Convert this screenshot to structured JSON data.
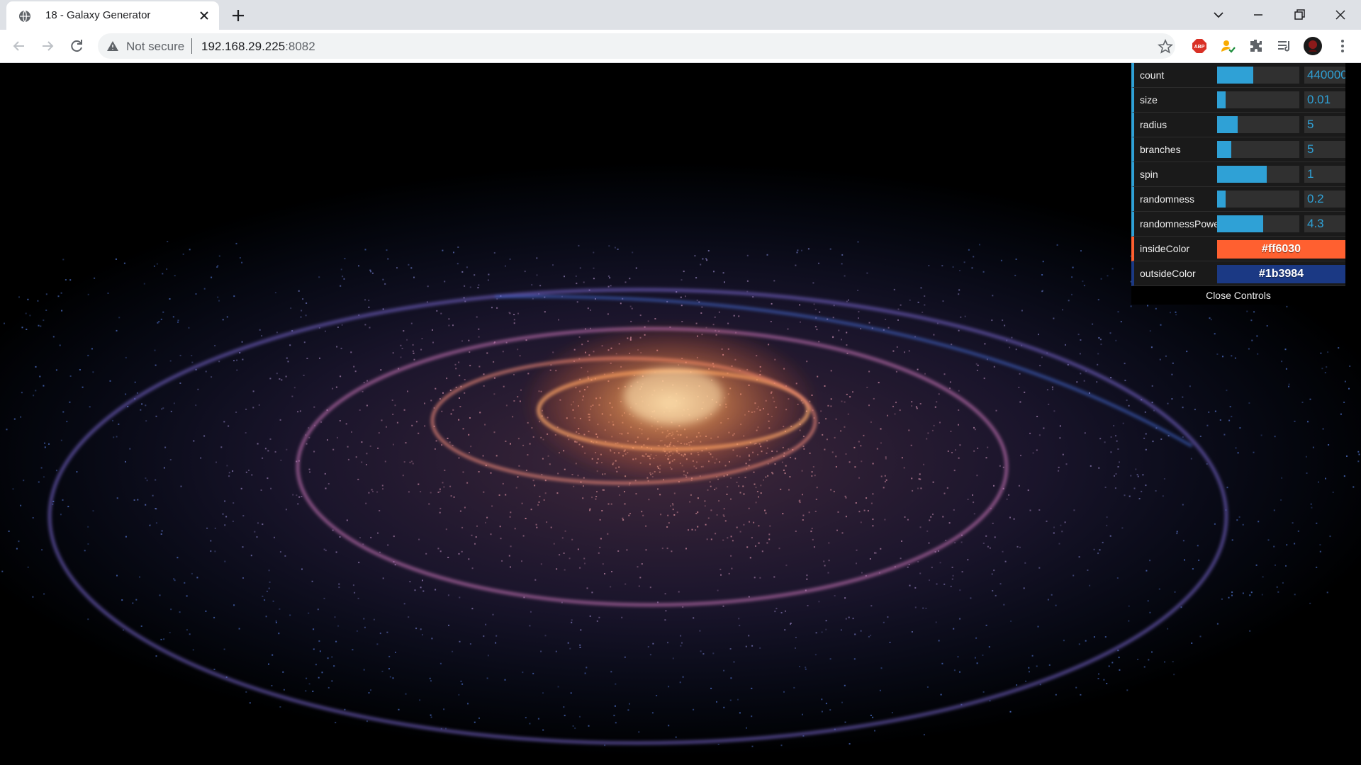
{
  "browser": {
    "tab_title": "18 - Galaxy Generator",
    "security_label": "Not secure",
    "url_host": "192.168.29.225",
    "url_port": ":8082"
  },
  "gui": {
    "controls": [
      {
        "label": "count",
        "value": "440000",
        "fill": 0.44
      },
      {
        "label": "size",
        "value": "0.01",
        "fill": 0.1
      },
      {
        "label": "radius",
        "value": "5",
        "fill": 0.25
      },
      {
        "label": "branches",
        "value": "5",
        "fill": 0.17
      },
      {
        "label": "spin",
        "value": "1",
        "fill": 0.6
      },
      {
        "label": "randomness",
        "value": "0.2",
        "fill": 0.1
      },
      {
        "label": "randomnessPower",
        "value": "4.3",
        "fill": 0.56
      }
    ],
    "colors": [
      {
        "label": "insideColor",
        "value": "#ff6030",
        "color": "#ff6030"
      },
      {
        "label": "outsideColor",
        "value": "#1b3984",
        "color": "#1b3984"
      }
    ],
    "close_label": "Close Controls"
  },
  "icons": {
    "favicon": "globe-icon",
    "tab_close": "close-icon",
    "new_tab": "plus-icon",
    "back": "arrow-left-icon",
    "forward": "arrow-right-icon",
    "reload": "reload-icon",
    "warning": "warning-triangle-icon",
    "bookmark": "star-icon"
  },
  "colors": {
    "accent": "#2fa1d6",
    "inside": "#ff6030",
    "outside": "#1b3984"
  }
}
